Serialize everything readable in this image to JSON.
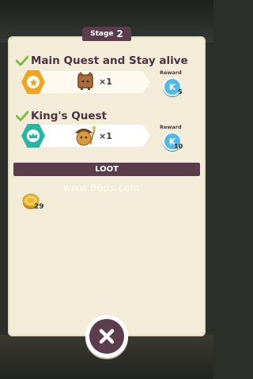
{
  "stage": {
    "label": "Stage",
    "number": "2"
  },
  "quests": [
    {
      "title": "Main Quest and Stay alive",
      "icon": "star-icon",
      "item_icon": "wooden-crate-character-icon",
      "item_qty": "×1",
      "reward_label": "Reward",
      "reward_icon_text": "K",
      "reward_count": "5"
    },
    {
      "title": "King's Quest",
      "icon": "crown-icon",
      "item_icon": "acorn-character-icon",
      "item_qty": "×1",
      "reward_label": "Reward",
      "reward_icon_text": "K",
      "reward_count": "10"
    }
  ],
  "loot": {
    "title": "LOOT",
    "items": [
      {
        "icon": "gold-coin-icon",
        "count": "29"
      }
    ]
  },
  "watermark": "www.86ps.com",
  "close_button": {
    "icon": "close-icon"
  },
  "colors": {
    "panel": "#f2ecd8",
    "header": "#5b3d4d",
    "check": "#7bbf3a",
    "gold_hex": "#efa51f",
    "teal_hex": "#27b6a2",
    "reward_blue": "#52b8e8"
  }
}
